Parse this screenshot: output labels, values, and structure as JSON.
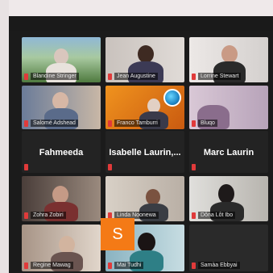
{
  "participants": [
    {
      "label": "Blandine Stringer"
    },
    {
      "label": "Jean Augustine"
    },
    {
      "label": "Lorrine Stewart"
    },
    {
      "label": "Salomé Adshead"
    },
    {
      "label": "Franco Tamburri"
    },
    {
      "label": "Bluqo"
    },
    {
      "label": "Fahmeeda"
    },
    {
      "label": "Isabelle Laurin,..."
    },
    {
      "label": "Marc Laurin"
    },
    {
      "label": "Zohra Zobiri"
    },
    {
      "label": "Linda Noonewa"
    },
    {
      "label": "Dôna Lôt Ibo"
    },
    {
      "label": "Regine Mawag"
    },
    {
      "label": "Mai Tudhi"
    },
    {
      "label": "Samàa Ebbyai"
    }
  ],
  "avatar_initial": "S",
  "colors": {
    "mic_muted": "#e03a3a",
    "avatar_bg": "#f47a16"
  }
}
